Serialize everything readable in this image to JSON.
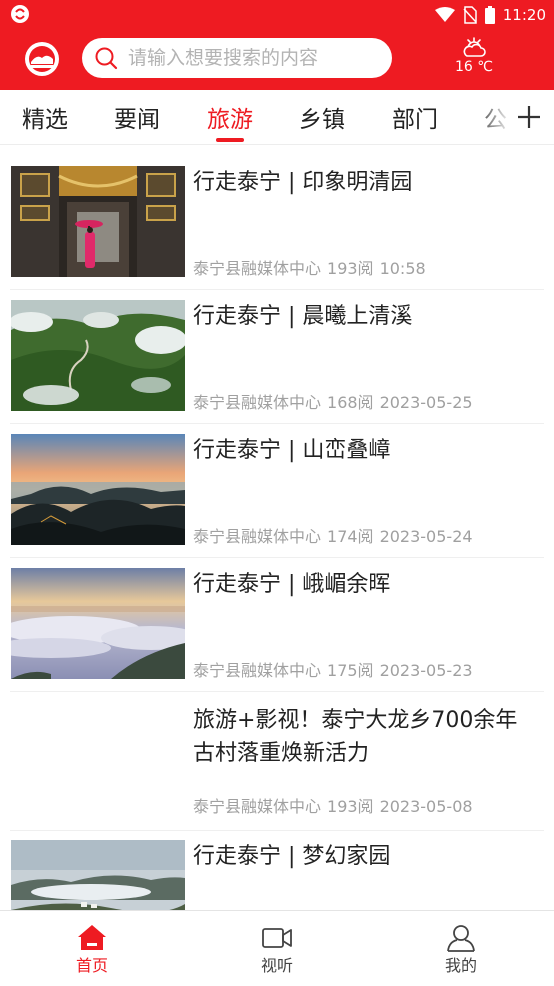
{
  "status_bar": {
    "time": "11:20",
    "icons": [
      "app-notification-icon",
      "wifi-icon",
      "no-sim-icon",
      "battery-icon"
    ]
  },
  "header": {
    "logo": "app-logo",
    "search": {
      "placeholder": "请输入想要搜索的内容",
      "icon": "search-icon"
    },
    "weather": {
      "icon": "partly-cloudy-icon",
      "temperature": "16 ℃"
    }
  },
  "tabs": {
    "items": [
      "精选",
      "要闻",
      "旅游",
      "乡镇",
      "部门",
      "公"
    ],
    "active": "旅游",
    "add_icon": "plus-icon"
  },
  "articles": [
    {
      "title": "行走泰宁 | 印象明清园",
      "source": "泰宁县融媒体中心",
      "views": "193阅",
      "time": "10:58",
      "has_image": true,
      "image": "ancient-hall-woman-red-dress"
    },
    {
      "title": "行走泰宁 | 晨曦上清溪",
      "source": "泰宁县融媒体中心",
      "views": "168阅",
      "time": "2023-05-25",
      "has_image": true,
      "image": "green-mountains-winding-road"
    },
    {
      "title": "行走泰宁 | 山峦叠嶂",
      "source": "泰宁县融媒体中心",
      "views": "174阅",
      "time": "2023-05-24",
      "has_image": true,
      "image": "sunrise-mountain-ridges"
    },
    {
      "title": "行走泰宁 | 峨嵋余晖",
      "source": "泰宁县融媒体中心",
      "views": "175阅",
      "time": "2023-05-23",
      "has_image": true,
      "image": "sea-of-clouds-dusk"
    },
    {
      "title": "旅游+影视！泰宁大龙乡700余年古村落重焕新活力",
      "source": "泰宁县融媒体中心",
      "views": "193阅",
      "time": "2023-05-08",
      "has_image": false
    },
    {
      "title": "行走泰宁 | 梦幻家园",
      "source": "",
      "views": "",
      "time": "",
      "has_image": true,
      "image": "misty-village-landscape"
    }
  ],
  "bottom_nav": {
    "items": [
      {
        "label": "首页",
        "icon": "home-icon",
        "active": true
      },
      {
        "label": "视听",
        "icon": "video-camera-icon",
        "active": false
      },
      {
        "label": "我的",
        "icon": "user-icon",
        "active": false
      }
    ]
  },
  "colors": {
    "brand_red": "#ee1b22",
    "meta_gray": "#a0a0a0",
    "text_dark": "#222222"
  }
}
